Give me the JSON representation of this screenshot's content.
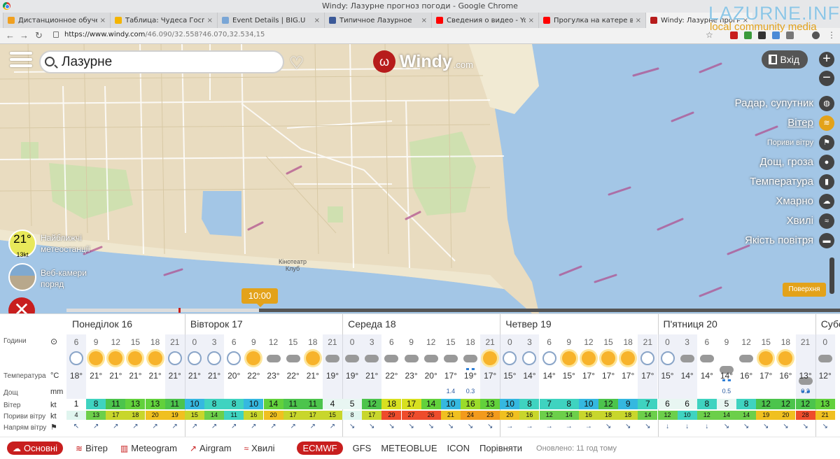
{
  "browser": {
    "window_title": "Windy: Лазурне прогноз погоди - Google Chrome",
    "tabs": [
      {
        "title": "Дистанционное обучение с",
        "fav": "#f0a020"
      },
      {
        "title": "Таблица: Чудеса Господа на",
        "fav": "#f4b400"
      },
      {
        "title": "Event Details | BIG.U",
        "fav": "#7aa6d6"
      },
      {
        "title": "Типичное Лазурное",
        "fav": "#3b5998"
      },
      {
        "title": "Сведения о видео - YouTube",
        "fav": "#ff0000"
      },
      {
        "title": "Прогулка на катере вдоль",
        "fav": "#ff0000"
      },
      {
        "title": "Windy: Лазурне прогноз",
        "fav": "#b71c1c",
        "active": true
      }
    ],
    "url_host": "https://www.windy.com",
    "url_path": "/46.090/32.558?46.070,32.534,15"
  },
  "watermark": {
    "line1": "LAZURNE.INFO",
    "line2": "local community media"
  },
  "map": {
    "search_value": "Лазурне",
    "logo_name": "Windy",
    "logo_tld": ".com",
    "login": "Вхід",
    "overlays": [
      {
        "label": "Радар, супутник",
        "icon": "globe-icon"
      },
      {
        "label": "Вітер",
        "icon": "wind-icon",
        "active": true
      },
      {
        "label": "Пориви вітру",
        "icon": "flag-icon",
        "small": true
      },
      {
        "label": "Дощ, гроза",
        "icon": "drop-icon"
      },
      {
        "label": "Температура",
        "icon": "thermometer-icon"
      },
      {
        "label": "Хмарно",
        "icon": "cloud-icon"
      },
      {
        "label": "Хвилі",
        "icon": "waves-icon"
      },
      {
        "label": "Якість повітря",
        "icon": "car-icon"
      }
    ],
    "layer_badge": "Поверхня",
    "station_temp": "21°",
    "station_wind": "13kt",
    "station_text": [
      "Найближчі",
      "метеостанції"
    ],
    "webcam_text": [
      "Веб-камери",
      "поряд"
    ],
    "cinema_label": [
      "Кінотеатр",
      "Клуб"
    ],
    "time_tag": "10:00"
  },
  "forecast": {
    "days": [
      "Понеділок 16",
      "Вівторок 17",
      "Середа 18",
      "Четвер 19",
      "П'ятниця 20",
      "Субо"
    ],
    "labels": {
      "hours": "Години",
      "temp": "Температура",
      "rain": "Дощ",
      "wind": "Вітер",
      "gust": "Пориви вітру",
      "dir": "Напрям вітру"
    },
    "units": {
      "temp": "°C",
      "rain": "mm",
      "wind": "kt",
      "gust": "kt"
    },
    "hours": [
      "6",
      "9",
      "12",
      "15",
      "18",
      "21",
      "0",
      "3",
      "6",
      "9",
      "12",
      "15",
      "18",
      "21",
      "0",
      "3",
      "6",
      "9",
      "12",
      "15",
      "18",
      "21",
      "0",
      "3",
      "6",
      "9",
      "12",
      "15",
      "18",
      "21",
      "0",
      "3",
      "6",
      "9",
      "12",
      "15",
      "18",
      "21",
      "0"
    ],
    "icons": [
      "moon",
      "sun",
      "sun",
      "sun",
      "sun",
      "moon",
      "moon",
      "moon",
      "moon",
      "sun",
      "cloud",
      "cloud",
      "sun",
      "cloud",
      "cloud",
      "cloud",
      "cloud",
      "cloud",
      "cloud",
      "cloud",
      "rain",
      "sun",
      "moon",
      "moon",
      "moon",
      "sun",
      "sun",
      "sun",
      "sun",
      "moon",
      "moon",
      "cloud",
      "cloud",
      "rain",
      "cloud",
      "sun",
      "sun",
      "rain",
      "cloud"
    ],
    "temps": [
      "18°",
      "21°",
      "21°",
      "21°",
      "21°",
      "21°",
      "21°",
      "21°",
      "20°",
      "22°",
      "23°",
      "22°",
      "21°",
      "19°",
      "19°",
      "21°",
      "22°",
      "23°",
      "20°",
      "17°",
      "19°",
      "17°",
      "15°",
      "14°",
      "14°",
      "15°",
      "17°",
      "17°",
      "17°",
      "17°",
      "15°",
      "14°",
      "14°",
      "14°",
      "16°",
      "17°",
      "16°",
      "13°",
      "12°"
    ],
    "rain": [
      "",
      "",
      "",
      "",
      "",
      "",
      "",
      "",
      "",
      "",
      "",
      "",
      "",
      "",
      "",
      "",
      "",
      "",
      "",
      "1.4",
      "0.3",
      "",
      "",
      "",
      "",
      "",
      "",
      "",
      "",
      "",
      "",
      "",
      "",
      "0.5",
      "",
      "",
      "",
      "0.2",
      ""
    ],
    "wind": [
      "1",
      "8",
      "11",
      "13",
      "13",
      "11",
      "10",
      "8",
      "8",
      "10",
      "14",
      "11",
      "11",
      "4",
      "5",
      "12",
      "18",
      "17",
      "14",
      "10",
      "16",
      "13",
      "10",
      "8",
      "7",
      "8",
      "10",
      "12",
      "9",
      "7",
      "6",
      "6",
      "8",
      "5",
      "8",
      "12",
      "12",
      "12",
      "13"
    ],
    "gust": [
      "4",
      "13",
      "17",
      "18",
      "20",
      "19",
      "15",
      "14",
      "11",
      "16",
      "20",
      "17",
      "17",
      "15",
      "8",
      "17",
      "29",
      "27",
      "26",
      "21",
      "24",
      "23",
      "20",
      "16",
      "12",
      "14",
      "16",
      "18",
      "18",
      "14",
      "12",
      "10",
      "12",
      "14",
      "14",
      "19",
      "20",
      "28",
      "21"
    ],
    "dir": [
      "↖",
      "↗",
      "↗",
      "↗",
      "↗",
      "↗",
      "↗",
      "↗",
      "↗",
      "↗",
      "↗",
      "↗",
      "↗",
      "↗",
      "↘",
      "↘",
      "↘",
      "↘",
      "↘",
      "↘",
      "↘",
      "↘",
      "→",
      "→",
      "→",
      "→",
      "→",
      "↘",
      "↘",
      "↘",
      "↓",
      "↓",
      "↓",
      "↘",
      "↘",
      "↘",
      "↘",
      "↘",
      "↘"
    ]
  },
  "footer": {
    "tabs": [
      {
        "label": "Основні",
        "icon": "cloud-sun-icon",
        "selected": true
      },
      {
        "label": "Вітер",
        "icon": "wind-icon"
      },
      {
        "label": "Meteogram",
        "icon": "meteogram-icon"
      },
      {
        "label": "Airgram",
        "icon": "airgram-icon"
      },
      {
        "label": "Хвилі",
        "icon": "waves-icon"
      }
    ],
    "models": [
      "ECMWF",
      "GFS",
      "METEOBLUE",
      "ICON",
      "Порівняти"
    ],
    "selected_model": "ECMWF",
    "updated": "Оновлено: 11 год тому"
  }
}
